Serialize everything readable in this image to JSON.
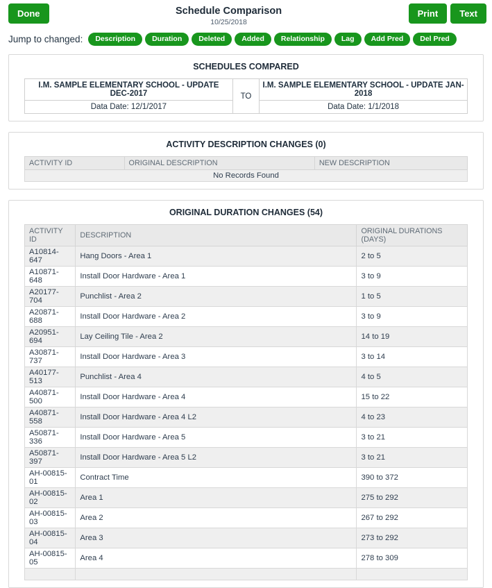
{
  "colors": {
    "accent_green": "#18961d"
  },
  "header": {
    "done_label": "Done",
    "title": "Schedule Comparison",
    "date": "10/25/2018",
    "print_label": "Print",
    "text_label": "Text"
  },
  "jump_bar": {
    "label": "Jump to changed:",
    "pills": [
      "Description",
      "Duration",
      "Deleted",
      "Added",
      "Relationship",
      "Lag",
      "Add Pred",
      "Del Pred"
    ]
  },
  "schedules_compared": {
    "title": "SCHEDULES COMPARED",
    "left": {
      "name": "I.M. SAMPLE ELEMENTARY SCHOOL - UPDATE DEC-2017",
      "data_date": "Data Date: 12/1/2017"
    },
    "separator": "TO",
    "right": {
      "name": "I.M. SAMPLE ELEMENTARY SCHOOL - UPDATE JAN-2018",
      "data_date": "Data Date: 1/1/2018"
    }
  },
  "description_changes": {
    "title": "ACTIVITY DESCRIPTION CHANGES (0)",
    "columns": [
      "ACTIVITY ID",
      "ORIGINAL DESCRIPTION",
      "NEW DESCRIPTION"
    ],
    "empty_text": "No Records Found"
  },
  "duration_changes": {
    "title": "ORIGINAL DURATION CHANGES (54)",
    "columns": [
      "ACTIVITY ID",
      "DESCRIPTION",
      "ORIGINAL DURATIONS (DAYS)"
    ],
    "rows": [
      {
        "activity_id": "A10814-647",
        "description": "Hang Doors - Area 1",
        "durations": "2 to 5"
      },
      {
        "activity_id": "A10871-648",
        "description": "Install Door Hardware - Area 1",
        "durations": "3 to 9"
      },
      {
        "activity_id": "A20177-704",
        "description": "Punchlist - Area 2",
        "durations": "1 to 5"
      },
      {
        "activity_id": "A20871-688",
        "description": "Install Door Hardware - Area 2",
        "durations": "3 to 9"
      },
      {
        "activity_id": "A20951-694",
        "description": "Lay Ceiling Tile - Area 2",
        "durations": "14 to 19"
      },
      {
        "activity_id": "A30871-737",
        "description": "Install Door Hardware - Area 3",
        "durations": "3 to 14"
      },
      {
        "activity_id": "A40177-513",
        "description": "Punchlist - Area 4",
        "durations": "4 to 5"
      },
      {
        "activity_id": "A40871-500",
        "description": "Install Door Hardware - Area 4",
        "durations": "15 to 22"
      },
      {
        "activity_id": "A40871-558",
        "description": "Install Door Hardware - Area 4 L2",
        "durations": "4 to 23"
      },
      {
        "activity_id": "A50871-336",
        "description": "Install Door Hardware - Area 5",
        "durations": "3 to 21"
      },
      {
        "activity_id": "A50871-397",
        "description": "Install Door Hardware - Area 5 L2",
        "durations": "3 to 21"
      },
      {
        "activity_id": "AH-00815-01",
        "description": "Contract Time",
        "durations": "390 to 372"
      },
      {
        "activity_id": "AH-00815-02",
        "description": "Area 1",
        "durations": "275 to 292"
      },
      {
        "activity_id": "AH-00815-03",
        "description": "Area 2",
        "durations": "267 to 292"
      },
      {
        "activity_id": "AH-00815-04",
        "description": "Area 3",
        "durations": "273 to 292"
      },
      {
        "activity_id": "AH-00815-05",
        "description": "Area 4",
        "durations": "278 to 309"
      }
    ]
  }
}
